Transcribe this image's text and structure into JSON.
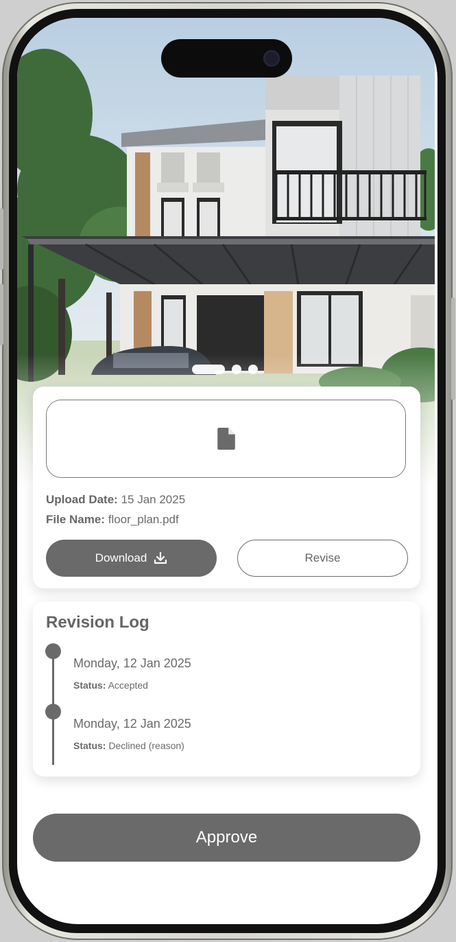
{
  "hero": {
    "image": "house-render",
    "carousel": {
      "count": 3,
      "active_index": 0
    }
  },
  "file": {
    "icon": "document-icon",
    "upload_date_label": "Upload Date:",
    "upload_date_value": "15 Jan 2025",
    "file_name_label": "File Name:",
    "file_name_value": "floor_plan.pdf",
    "download_label": "Download",
    "download_icon": "download-icon",
    "revise_label": "Revise"
  },
  "revision_log": {
    "title": "Revision Log",
    "entries": [
      {
        "date": "Monday, 12 Jan 2025",
        "status_label": "Status:",
        "status_value": "Accepted"
      },
      {
        "date": "Monday, 12 Jan 2025",
        "status_label": "Status:",
        "status_value": "Declined (reason)"
      }
    ]
  },
  "actions": {
    "approve_label": "Approve"
  },
  "colors": {
    "primary": "#6a6a6a",
    "surface": "#ffffff",
    "frame": "#d8d7cf"
  }
}
